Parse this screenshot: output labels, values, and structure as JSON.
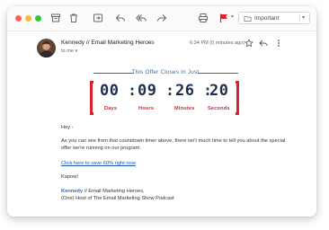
{
  "toolbar": {
    "window_controls": [
      "close",
      "minimize",
      "maximize"
    ],
    "icons": [
      "archive-icon",
      "trash-icon",
      "reply-icon",
      "reply-all-icon",
      "forward-icon",
      "print-icon",
      "flag-icon"
    ],
    "label_folder": "Important"
  },
  "message": {
    "sender": "Kennedy // Email Marketing Heroes",
    "to": "to me",
    "time": "6:34 PM (0 minutes ago)"
  },
  "timer": {
    "title": "This Offer Closes In Just",
    "days": "00",
    "hours": "09",
    "minutes": "26",
    "seconds": "20",
    "labels": {
      "days": "Days",
      "hours": "Hours",
      "minutes": "Minutes",
      "seconds": "Seconds"
    }
  },
  "content": {
    "greeting": "Hey -",
    "paragraph_line1": "As you can see from that countdown timer above, there isn't much time to tell you about the special",
    "paragraph_line2": "offer we're running on our program.",
    "link": "Click here to save 60% right now",
    "closing": "Kapow!",
    "signature_name": "Kennedy",
    "signature_rest": " // Email Marketing Heroes,",
    "signature_line2": "(One) Host of The Email Marketing Show Podcast"
  },
  "colors": {
    "accent_blue": "#2f6fae",
    "timer_red": "#d8232f",
    "digits_navy": "#1e2f4d",
    "flag_red": "#e02424"
  }
}
